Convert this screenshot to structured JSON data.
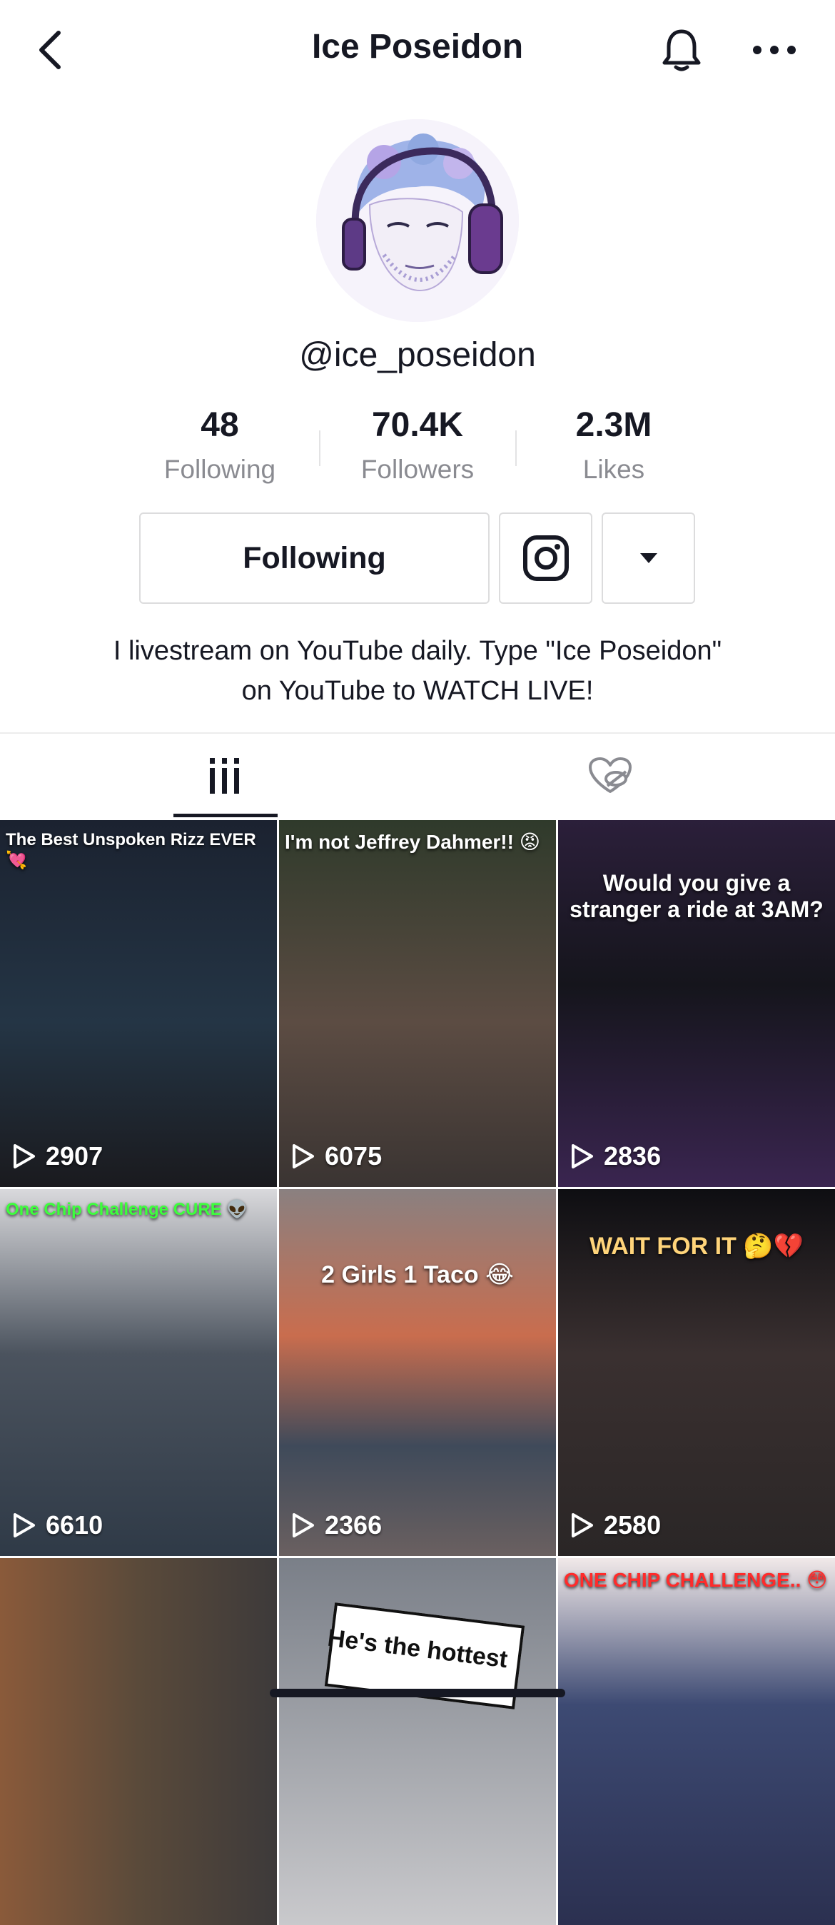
{
  "header": {
    "title": "Ice Poseidon"
  },
  "profile": {
    "handle": "@ice_poseidon",
    "stats": [
      {
        "value": "48",
        "label": "Following"
      },
      {
        "value": "70.4K",
        "label": "Followers"
      },
      {
        "value": "2.3M",
        "label": "Likes"
      }
    ],
    "following_button": "Following",
    "bio_line1": "I livestream on YouTube daily. Type \"Ice Poseidon\"",
    "bio_line2": "on YouTube to WATCH LIVE!"
  },
  "icons": {
    "back": "chevron-left-icon",
    "bell": "bell-icon",
    "more": "more-horizontal-icon",
    "instagram": "instagram-icon",
    "dropdown": "caret-down-icon",
    "videos_tab": "grid-bars-icon",
    "liked_tab": "hidden-heart-icon",
    "play": "play-outline-icon"
  },
  "videos": [
    {
      "caption": "The Best Unspoken Rizz EVER 💘",
      "views": "2907",
      "bg": "#1f2a38"
    },
    {
      "caption": "I'm not Jeffrey Dahmer!! 😡",
      "views": "6075",
      "bg": "#3a3b32"
    },
    {
      "caption": "Would you give a stranger a ride at 3AM?",
      "views": "2836",
      "bg": "#2c1f3d"
    },
    {
      "caption": "One Chip Challenge CURE 👽",
      "views": "6610",
      "bg": "#4a5058"
    },
    {
      "caption": "2 Girls 1 Taco 😂",
      "views": "2366",
      "bg": "#5b4d49"
    },
    {
      "caption": "WAIT FOR IT 🤔💔",
      "views": "2580",
      "bg": "#231f22"
    },
    {
      "caption": "",
      "views": "",
      "bg": "#7a5a3d"
    },
    {
      "caption": "He's the hottest",
      "views": "",
      "bg": "#6b6f78"
    },
    {
      "caption": "ONE CHIP CHALLENGE.. 😳",
      "views": "",
      "bg": "#3d4a73"
    }
  ],
  "colors": {
    "text_primary": "#161823",
    "text_secondary": "#8a8b91",
    "border": "#dcdcdd"
  }
}
